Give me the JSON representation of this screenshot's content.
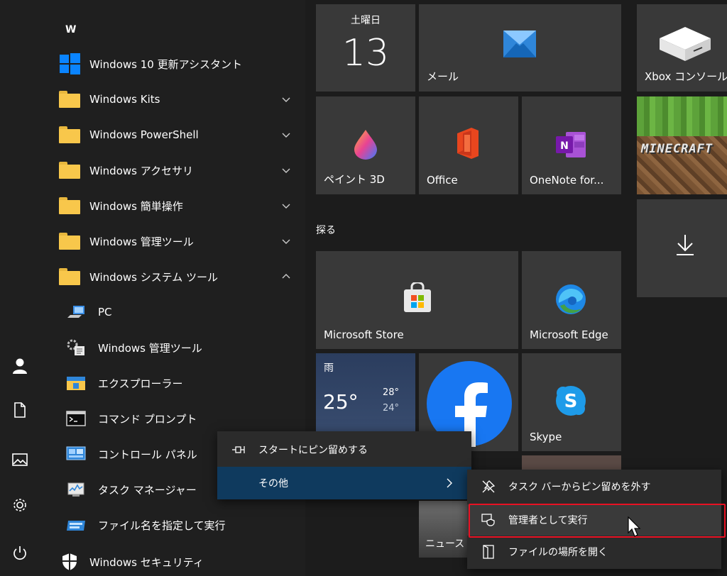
{
  "app_list": {
    "letter": "W",
    "items": [
      {
        "label": "Windows 10 更新アシスタント"
      },
      {
        "label": "Windows Kits"
      },
      {
        "label": "Windows PowerShell"
      },
      {
        "label": "Windows アクセサリ"
      },
      {
        "label": "Windows 簡単操作"
      },
      {
        "label": "Windows 管理ツール"
      },
      {
        "label": "Windows システム ツール"
      },
      {
        "label": "PC"
      },
      {
        "label": "Windows 管理ツール"
      },
      {
        "label": "エクスプローラー"
      },
      {
        "label": "コマンド プロンプト"
      },
      {
        "label": "コントロール パネル"
      },
      {
        "label": "タスク マネージャー"
      },
      {
        "label": "ファイル名を指定して実行"
      },
      {
        "label": "Windows セキュリティ"
      }
    ]
  },
  "tiles": {
    "calendar": {
      "day": "土曜日",
      "date": "13"
    },
    "mail": {
      "label": "メール"
    },
    "xbox": {
      "label": "Xbox コンソール..."
    },
    "paint3d": {
      "label": "ペイント 3D"
    },
    "office": {
      "label": "Office"
    },
    "onenote": {
      "label": "OneNote for..."
    },
    "minecraft": {
      "text": "MINECRAFT"
    },
    "group_label": "探る",
    "store": {
      "label": "Microsoft Store"
    },
    "edge": {
      "label": "Microsoft Edge"
    },
    "weather": {
      "condition": "雨",
      "temp": "25°",
      "high": "28°",
      "low": "24°"
    },
    "skype": {
      "label": "Skype"
    },
    "news": {
      "label": "ニュース"
    }
  },
  "context_menu": {
    "pin_start": "スタートにピン留めする",
    "more": "その他"
  },
  "submenu": {
    "unpin_taskbar": "タスク バーからピン留めを外す",
    "run_as_admin": "管理者として実行",
    "open_location": "ファイルの場所を開く"
  },
  "colors": {
    "accent": "#0078d7",
    "highlight_border": "#e81123",
    "folder": "#f8c74b"
  }
}
